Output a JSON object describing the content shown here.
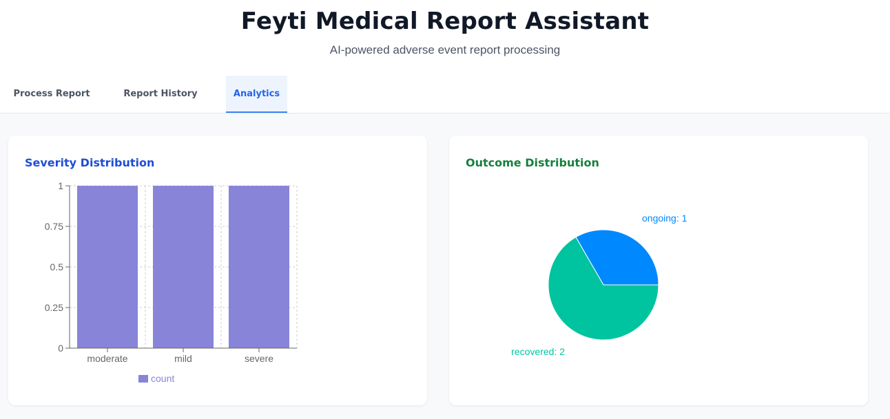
{
  "header": {
    "title": "Feyti Medical Report Assistant",
    "subtitle": "AI-powered adverse event report processing"
  },
  "tabs": [
    {
      "label": "Process Report",
      "active": false
    },
    {
      "label": "Report History",
      "active": false
    },
    {
      "label": "Analytics",
      "active": true
    }
  ],
  "cards": {
    "severity": {
      "title": "Severity Distribution"
    },
    "outcome": {
      "title": "Outcome Distribution"
    }
  },
  "colors": {
    "bar": "#8884d8",
    "ongoing": "#0088fe",
    "recovered": "#00c49f"
  },
  "chart_data": [
    {
      "type": "bar",
      "title": "Severity Distribution",
      "categories": [
        "moderate",
        "mild",
        "severe"
      ],
      "series": [
        {
          "name": "count",
          "values": [
            1,
            1,
            1
          ]
        }
      ],
      "ylim": [
        0,
        1
      ],
      "yticks": [
        0,
        0.25,
        0.5,
        0.75,
        1
      ],
      "ytick_labels": [
        "0",
        "0.25",
        "0.5",
        "0.75",
        "1"
      ],
      "grid": true,
      "legend": "bottom"
    },
    {
      "type": "pie",
      "title": "Outcome Distribution",
      "slices": [
        {
          "label": "ongoing: 1",
          "name": "ongoing",
          "value": 1
        },
        {
          "label": "recovered: 2",
          "name": "recovered",
          "value": 2
        }
      ]
    }
  ]
}
